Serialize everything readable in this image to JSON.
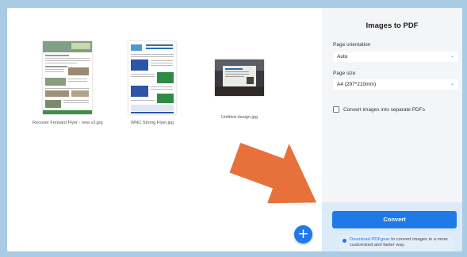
{
  "thumbnails": [
    {
      "caption": "Recover Forward Flyer - new v2.jpg"
    },
    {
      "caption": "WNC Strong Flyer.jpg"
    },
    {
      "caption": "Untitled design.jpg"
    }
  ],
  "panel": {
    "title": "Images to PDF",
    "orientation_label": "Page orientation",
    "orientation_value": "Auto",
    "size_label": "Page size",
    "size_value": "A4 (297*210mm)",
    "separate_label": "Convert images into separate PDFs",
    "separate_checked": false,
    "convert_label": "Convert",
    "tip_link": "Download PDFgear",
    "tip_text": " to convert images in a more customized and faster way."
  },
  "add_label": "+",
  "colors": {
    "accent": "#1f7ae8",
    "arrow": "#e8703a",
    "frame": "#a9cbe4"
  }
}
